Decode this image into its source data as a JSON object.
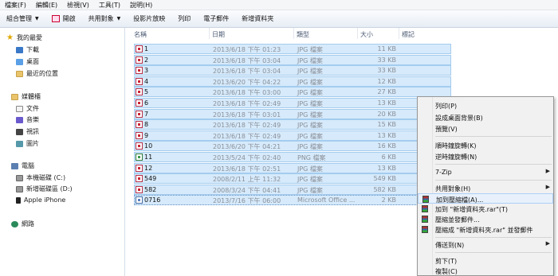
{
  "menubar": [
    "檔案(F)",
    "編輯(E)",
    "檢視(V)",
    "工具(T)",
    "說明(H)"
  ],
  "toolbar": {
    "organize": "組合管理",
    "open": "開啟",
    "share": "共用對象",
    "slideshow": "投影片放映",
    "print": "列印",
    "email": "電子郵件",
    "new_folder": "新增資料夾"
  },
  "sidebar": {
    "favorites": "我的最愛",
    "downloads": "下載",
    "desktop": "桌面",
    "recent": "最近的位置",
    "libraries": "媒體櫃",
    "documents": "文件",
    "music": "音樂",
    "videos": "視訊",
    "pictures": "圖片",
    "computer": "電腦",
    "drive_c": "本機磁碟 (C:)",
    "drive_d": "新增磁碟區 (D:)",
    "iphone": "Apple iPhone",
    "network": "網路"
  },
  "columns": {
    "name": "名稱",
    "date": "日期",
    "type": "類型",
    "size": "大小",
    "tags": "標記"
  },
  "files": [
    {
      "name": "1",
      "date": "2013/6/18 下午 01:23",
      "type": "JPG 檔案",
      "size": "11 KB",
      "kind": "jpg"
    },
    {
      "name": "2",
      "date": "2013/6/18 下午 03:04",
      "type": "JPG 檔案",
      "size": "33 KB",
      "kind": "jpg"
    },
    {
      "name": "3",
      "date": "2013/6/18 下午 03:04",
      "type": "JPG 檔案",
      "size": "33 KB",
      "kind": "jpg"
    },
    {
      "name": "4",
      "date": "2013/6/20 下午 04:22",
      "type": "JPG 檔案",
      "size": "12 KB",
      "kind": "jpg"
    },
    {
      "name": "5",
      "date": "2013/6/18 下午 03:00",
      "type": "JPG 檔案",
      "size": "27 KB",
      "kind": "jpg"
    },
    {
      "name": "6",
      "date": "2013/6/18 下午 02:49",
      "type": "JPG 檔案",
      "size": "13 KB",
      "kind": "jpg"
    },
    {
      "name": "7",
      "date": "2013/6/18 下午 03:01",
      "type": "JPG 檔案",
      "size": "20 KB",
      "kind": "jpg"
    },
    {
      "name": "8",
      "date": "2013/6/18 下午 02:49",
      "type": "JPG 檔案",
      "size": "15 KB",
      "kind": "jpg"
    },
    {
      "name": "9",
      "date": "2013/6/18 下午 02:49",
      "type": "JPG 檔案",
      "size": "13 KB",
      "kind": "jpg"
    },
    {
      "name": "10",
      "date": "2013/6/20 下午 04:21",
      "type": "JPG 檔案",
      "size": "16 KB",
      "kind": "jpg"
    },
    {
      "name": "11",
      "date": "2013/5/24 下午 02:40",
      "type": "PNG 檔案",
      "size": "6 KB",
      "kind": "png"
    },
    {
      "name": "12",
      "date": "2013/6/18 下午 02:51",
      "type": "JPG 檔案",
      "size": "13 KB",
      "kind": "jpg"
    },
    {
      "name": "549",
      "date": "2008/2/11 上午 11:32",
      "type": "JPG 檔案",
      "size": "549 KB",
      "kind": "jpg"
    },
    {
      "name": "582",
      "date": "2008/3/24 下午 04:41",
      "type": "JPG 檔案",
      "size": "582 KB",
      "kind": "jpg"
    },
    {
      "name": "0716",
      "date": "2013/7/16 下午 06:00",
      "type": "Microsoft Office ...",
      "size": "2 KB",
      "kind": "office"
    }
  ],
  "context_menu": {
    "print": "列印(P)",
    "set_background": "設成桌面背景(B)",
    "preview": "預覽(V)",
    "rotate_cw": "順時鐘旋轉(K)",
    "rotate_ccw": "逆時鐘旋轉(N)",
    "sevenzip": "7-Zip",
    "share_with": "共用對象(H)",
    "add_to_archive": "加到壓縮檔(A)...",
    "add_to_rar": "加到 \"新增資料夾.rar\"(T)",
    "compress_email": "壓縮並發郵件...",
    "compress_rar_email": "壓縮成 \"新增資料夾.rar\" 並發郵件",
    "send_to": "傳送到(N)",
    "cut": "剪下(T)",
    "copy": "複製(C)"
  }
}
